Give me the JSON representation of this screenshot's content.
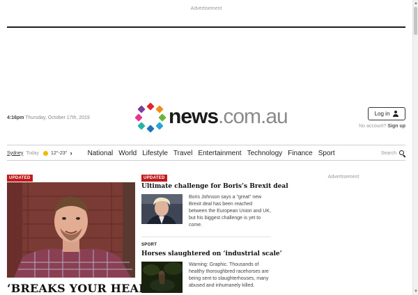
{
  "ads": {
    "top_label": "Advertisement",
    "right_label": "Advertisement"
  },
  "header": {
    "time": "4:16pm",
    "date": "Thursday, October 17th, 2019",
    "logo": {
      "bold": "news",
      "light": ".com.au"
    },
    "login_label": "Log in",
    "no_account": "No account?",
    "signup_label": "Sign up"
  },
  "weather": {
    "location": "Sydney",
    "day": "Today",
    "temps": "12°-23°",
    "icon": "sun-icon"
  },
  "nav": {
    "items": [
      "National",
      "World",
      "Lifestyle",
      "Travel",
      "Entertainment",
      "Technology",
      "Finance",
      "Sport"
    ],
    "search_label": "Search"
  },
  "lead": {
    "badge": "UPDATED",
    "headline": "‘BREAKS YOUR HEART’:"
  },
  "stories": [
    {
      "badge": "UPDATED",
      "title": "Ultimate challenge for Boris’s Brexit deal",
      "summary": "Boris Johnson says a \"great\" new Brexit deal has been reached between the European Union and UK, but his biggest challenge is yet to come."
    },
    {
      "section": "SPORT",
      "title": "Horses slaughtered on ‘industrial scale’",
      "summary": "Warning: Graphic. Thousands of healthy thoroughbred racehorses are being sent to slaughterhouses, many abused and inhumanely killed."
    }
  ],
  "colors": {
    "badge": "#c21a1a",
    "accent_dots": [
      "#e2262e",
      "#f28c1c",
      "#6ab43e",
      "#2aa3d9",
      "#7d3f98",
      "#e9338d",
      "#27b2a6",
      "#f6c400"
    ]
  }
}
